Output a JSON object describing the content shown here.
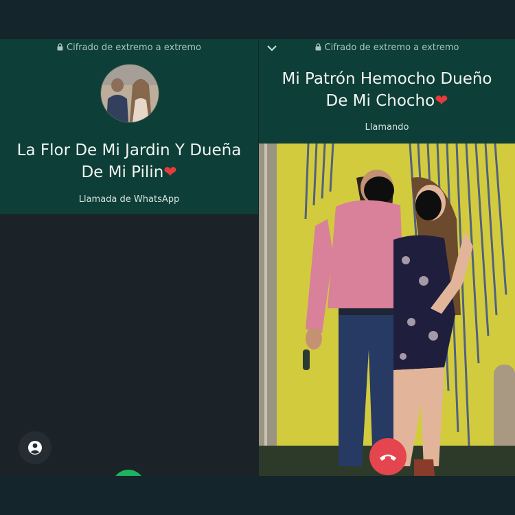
{
  "left_screen": {
    "encryption_text": "Cifrado de extremo a extremo",
    "contact_name_line1": "La Flor De Mi Jardin Y Dueña",
    "contact_name_line2": "De Mi Pilin",
    "heart": "❤",
    "status": "Llamada de WhatsApp",
    "icons": [
      "lock-icon",
      "profile-icon",
      "accept-call-icon"
    ]
  },
  "right_screen": {
    "encryption_text": "Cifrado de extremo a extremo",
    "contact_name_line1": "Mi Patrón Hemocho Dueño",
    "contact_name_line2": "De Mi Chocho",
    "heart": "❤",
    "status": "Llamando",
    "icons": [
      "chevron-down-icon",
      "lock-icon",
      "end-call-icon"
    ]
  },
  "colors": {
    "header": "#0d3e37",
    "background_dark": "#1b2328",
    "end_call_red": "#e5454f",
    "accept_green": "#1fb35f",
    "heart_red": "#e53b3b"
  }
}
